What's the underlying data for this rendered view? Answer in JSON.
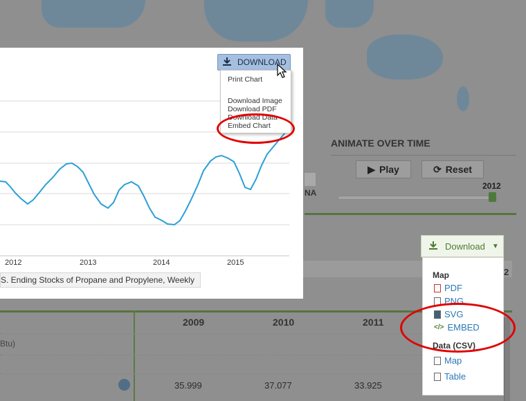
{
  "animate": {
    "title": "ANIMATE OVER TIME",
    "play_label": "Play",
    "reset_label": "Reset",
    "year": "2012"
  },
  "legend_fragment": {
    "na_label": "NA"
  },
  "chart_panel": {
    "x_ticks": [
      "2012",
      "2013",
      "2014",
      "2015"
    ],
    "legend_label": "S. Ending Stocks of Propane and Propylene, Weekly",
    "download_button": "DOWNLOAD",
    "menu": {
      "print": "Print Chart",
      "image": "Download Image",
      "pdf": "Download PDF",
      "data": "Download Data",
      "embed": "Embed Chart"
    },
    "line_color": "#2a9fd8"
  },
  "side_download": {
    "button_label": "Download",
    "map_heading": "Map",
    "map_links": [
      "PDF",
      "PNG",
      "SVG",
      "EMBED"
    ],
    "data_heading": "Data (CSV)",
    "data_links": [
      "Map",
      "Table"
    ]
  },
  "table": {
    "years": [
      "2009",
      "2010",
      "2011"
    ],
    "unit_fragment": "Btu)",
    "values": [
      "35.999",
      "37.077",
      "33.925"
    ],
    "edge_char": "2"
  },
  "colors": {
    "accent_green": "#4d7a31",
    "annotation_red": "#e00000",
    "link_blue": "#2a78b4"
  }
}
